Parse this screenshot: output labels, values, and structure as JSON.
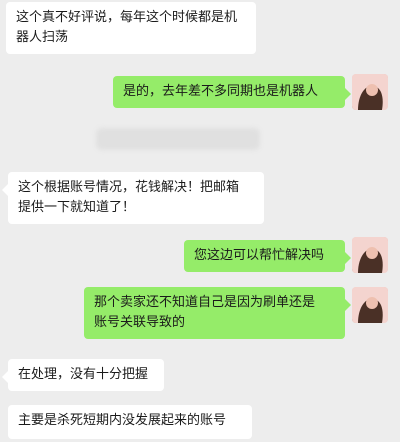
{
  "messages": [
    {
      "side": "in",
      "text": "这个真不好评说，每年这个时候都是机\n器人扫荡"
    },
    {
      "side": "out",
      "text": "是的，去年差不多同期也是机器人"
    },
    {
      "side": "in",
      "text": "这个根据账号情况，花钱解决！把邮箱\n提供一下就知道了！"
    },
    {
      "side": "out",
      "text": "您这边可以帮忙解决吗"
    },
    {
      "side": "out",
      "text": "那个卖家还不知道自己是因为刷单还是\n账号关联导致的"
    },
    {
      "side": "in",
      "text": "在处理，没有十分把握"
    },
    {
      "side": "in",
      "text": "主要是杀死短期内没发展起来的账号"
    }
  ],
  "colors": {
    "background": "#ededed",
    "incoming_bubble": "#ffffff",
    "outgoing_bubble": "#95ec69"
  }
}
